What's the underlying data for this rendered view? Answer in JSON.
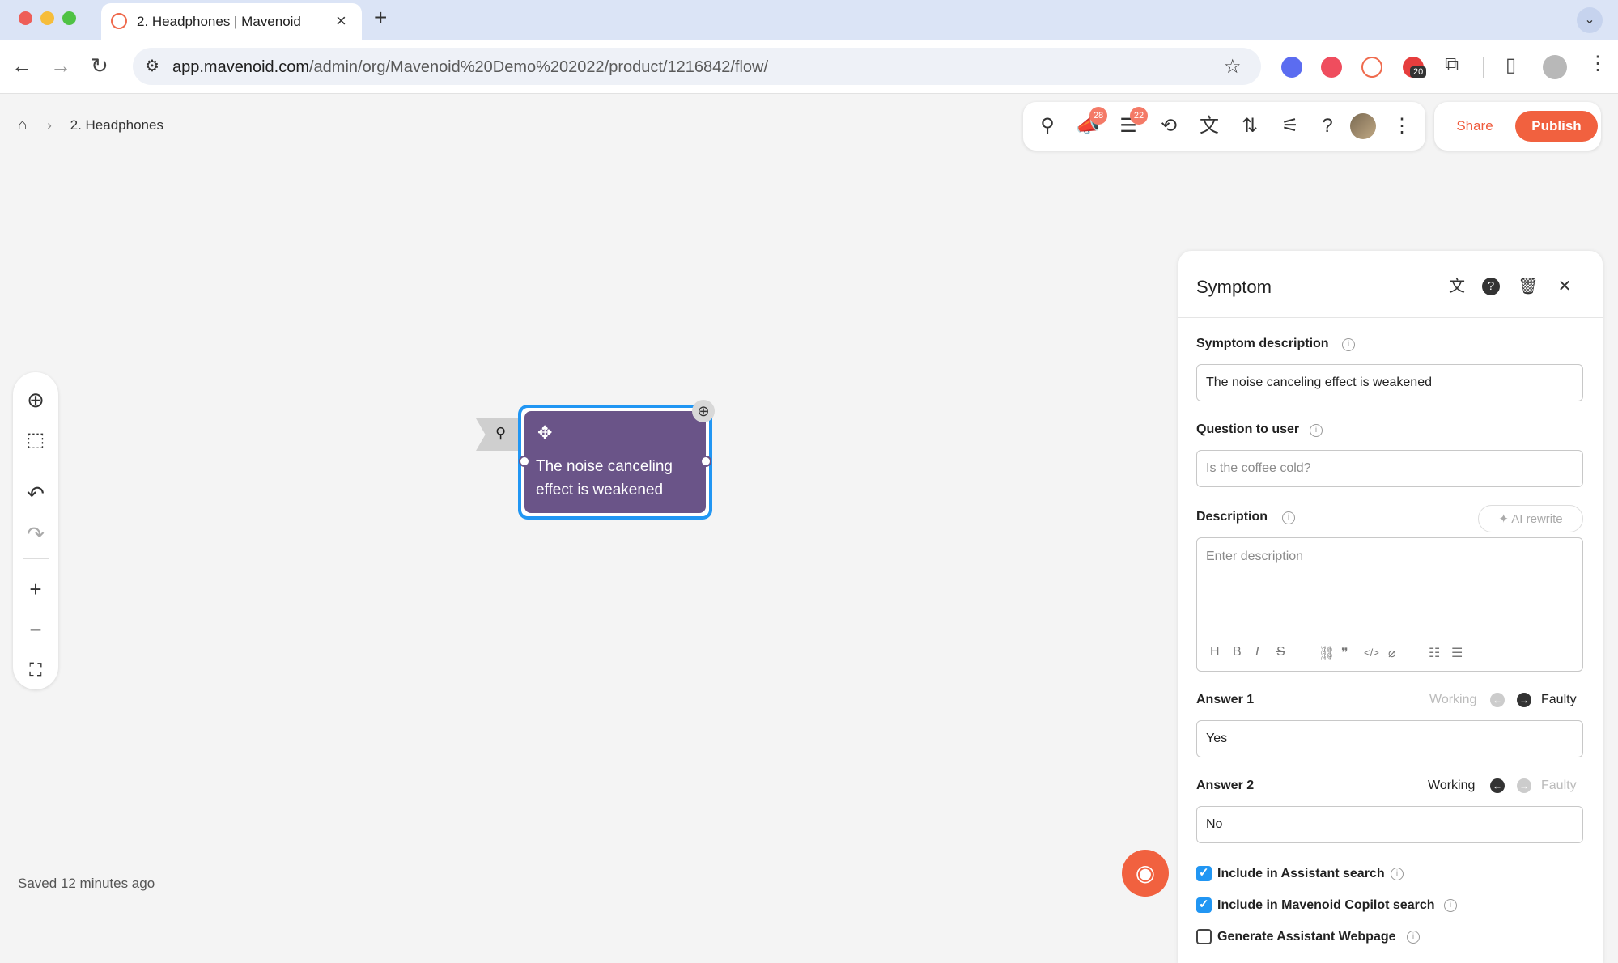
{
  "browser": {
    "tab_title": "2. Headphones | Mavenoid",
    "url_host": "app.mavenoid.com",
    "url_path": "/admin/org/Mavenoid%20Demo%202022/product/1216842/flow/",
    "extension_badge": "20"
  },
  "breadcrumb": {
    "current": "2. Headphones"
  },
  "toolbar": {
    "announcements_badge": "28",
    "chat_badge": "22",
    "share_label": "Share",
    "publish_label": "Publish"
  },
  "canvas": {
    "node_text": "The noise canceling effect is weakened",
    "saved_status": "Saved 12 minutes ago"
  },
  "panel": {
    "title": "Symptom",
    "symptom_description_label": "Symptom description",
    "symptom_description_value": "The noise canceling effect is weakened",
    "question_label": "Question to user",
    "question_placeholder": "Is the coffee cold?",
    "description_label": "Description",
    "ai_rewrite_label": "AI rewrite",
    "description_placeholder": "Enter description",
    "answer1_label": "Answer 1",
    "answer1_value": "Yes",
    "answer2_label": "Answer 2",
    "answer2_value": "No",
    "working_label": "Working",
    "faulty_label": "Faulty",
    "include_assistant_label": "Include in Assistant search",
    "include_copilot_label": "Include in Mavenoid Copilot search",
    "generate_webpage_label": "Generate Assistant Webpage"
  },
  "colors": {
    "accent": "#f1613f",
    "node": "#6a5488",
    "selection": "#2196f3"
  }
}
